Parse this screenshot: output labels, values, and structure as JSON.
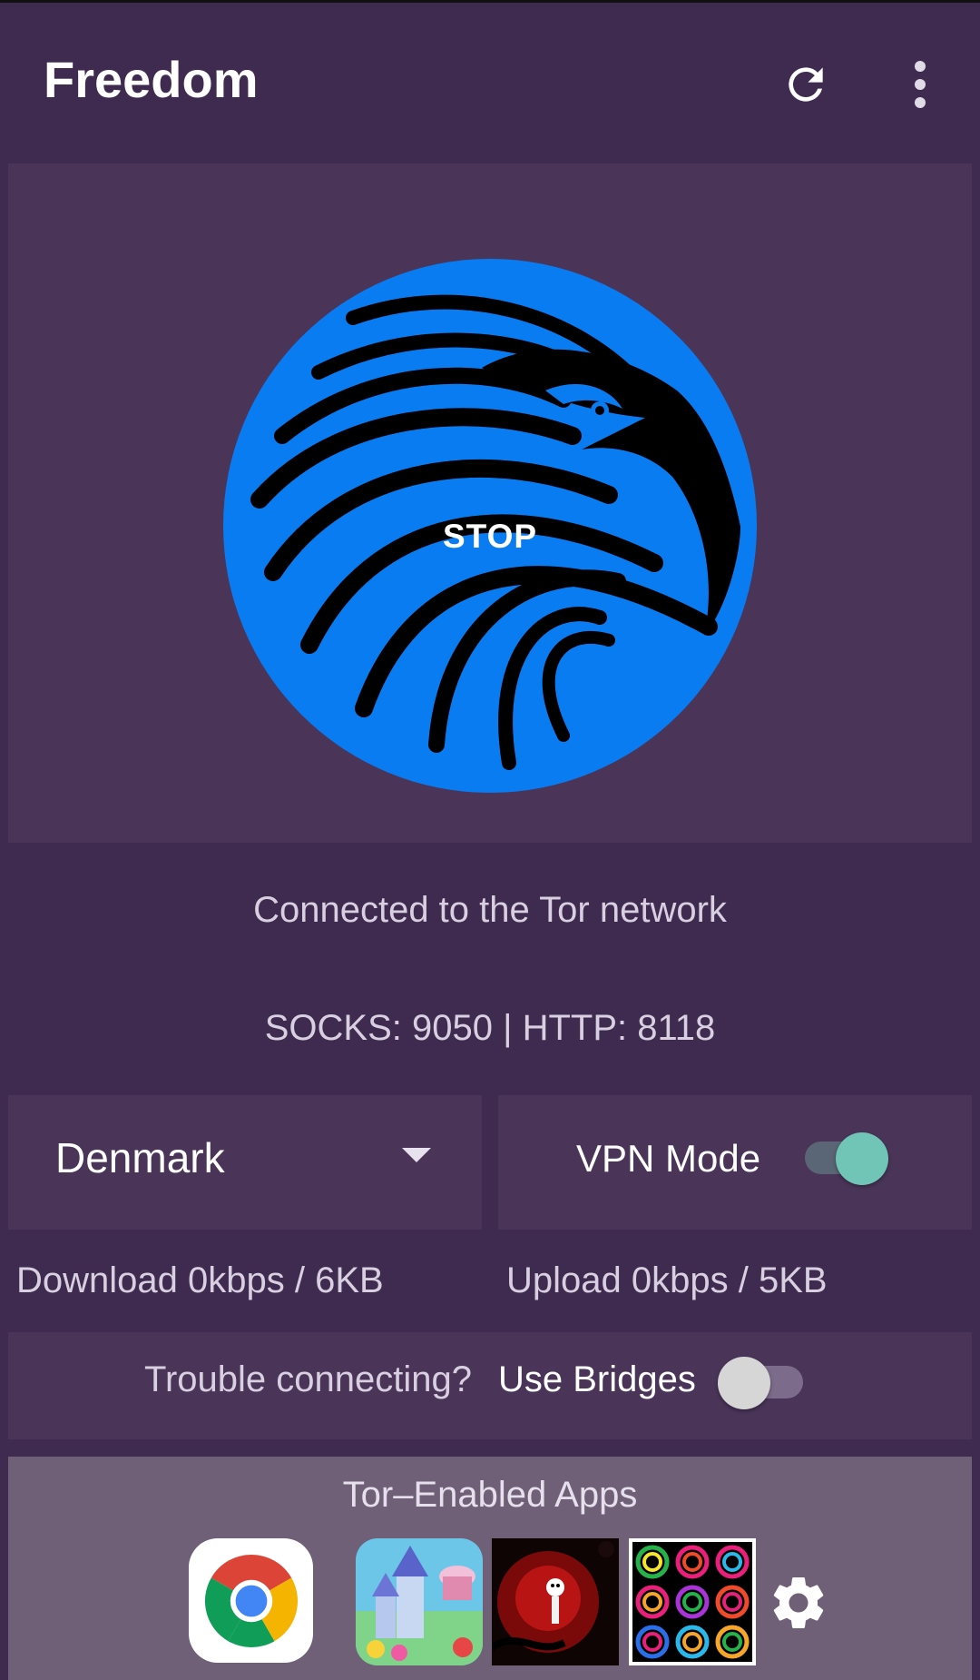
{
  "app": {
    "title": "Freedom"
  },
  "toolbar": {
    "refresh_icon": "refresh-icon",
    "menu_icon": "more-vertical-icon"
  },
  "hero": {
    "button_label": "STOP",
    "logo_icon": "eagle-logo",
    "logo_color": "#0a7cf2"
  },
  "status": {
    "connection": "Connected to the Tor network",
    "ports": "SOCKS: 9050 | HTTP: 8118"
  },
  "country": {
    "selected": "Denmark"
  },
  "vpn": {
    "label": "VPN Mode",
    "enabled": true,
    "accent": "#70c5b7"
  },
  "traffic": {
    "download": "Download  0kbps / 6KB",
    "upload": "Upload  0kbps / 5KB"
  },
  "bridges": {
    "question": "Trouble connecting?",
    "label": "Use Bridges",
    "enabled": false
  },
  "apps": {
    "title": "Tor–Enabled Apps",
    "items": [
      {
        "icon": "chrome-icon"
      },
      {
        "icon": "castle-puzzle-game-icon"
      },
      {
        "icon": "red-dark-game-icon"
      },
      {
        "icon": "color-rings-game-icon"
      }
    ],
    "settings_icon": "gear-icon"
  }
}
